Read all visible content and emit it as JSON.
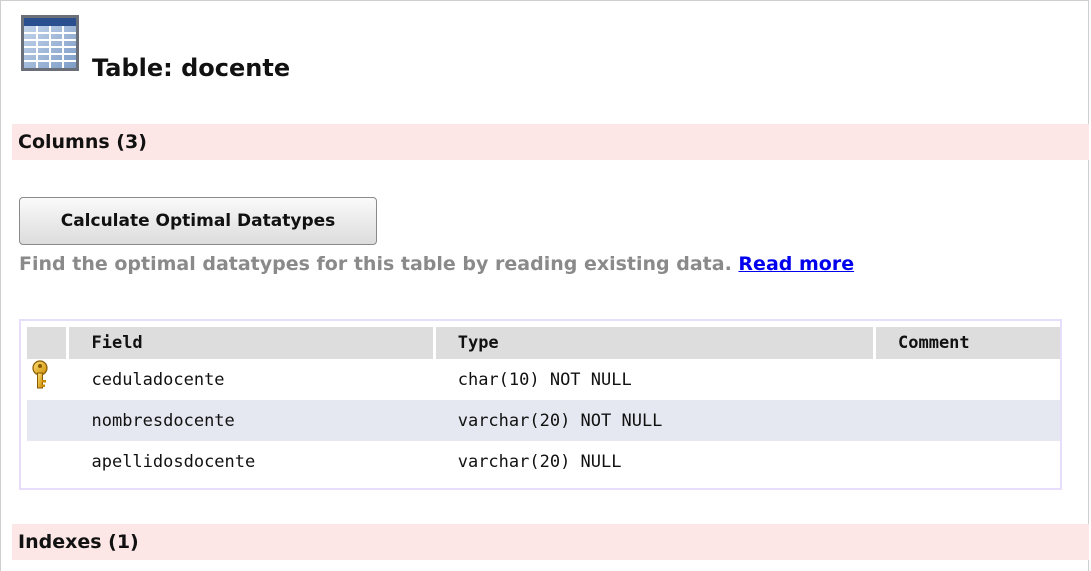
{
  "title": "Table: docente",
  "sections": {
    "columns_label": "Columns (3)",
    "indexes_label": "Indexes (1)"
  },
  "optimal": {
    "button_label": "Calculate Optimal Datatypes",
    "description": "Find the optimal datatypes for this table by reading existing data.",
    "link_label": "Read more"
  },
  "columns_table": {
    "headers": [
      "Field",
      "Type",
      "Comment"
    ],
    "rows": [
      {
        "key_icon": "primary-key-icon",
        "field": "ceduladocente",
        "type": "char(10) NOT NULL",
        "comment": ""
      },
      {
        "key_icon": "",
        "field": "nombresdocente",
        "type": "varchar(20) NOT NULL",
        "comment": ""
      },
      {
        "key_icon": "",
        "field": "apellidosdocente",
        "type": "varchar(20) NULL",
        "comment": ""
      }
    ]
  },
  "colors": {
    "section_bg": "#fde6e6",
    "alt_row_bg": "#e5e8f1",
    "header_bg": "#dddddd",
    "link": "#0000ee",
    "helper_text": "#8a8a8a",
    "table_border": "#e6defa"
  },
  "icons": {
    "title_icon": "table-grid-icon",
    "key_icon": "primary-key-icon"
  }
}
